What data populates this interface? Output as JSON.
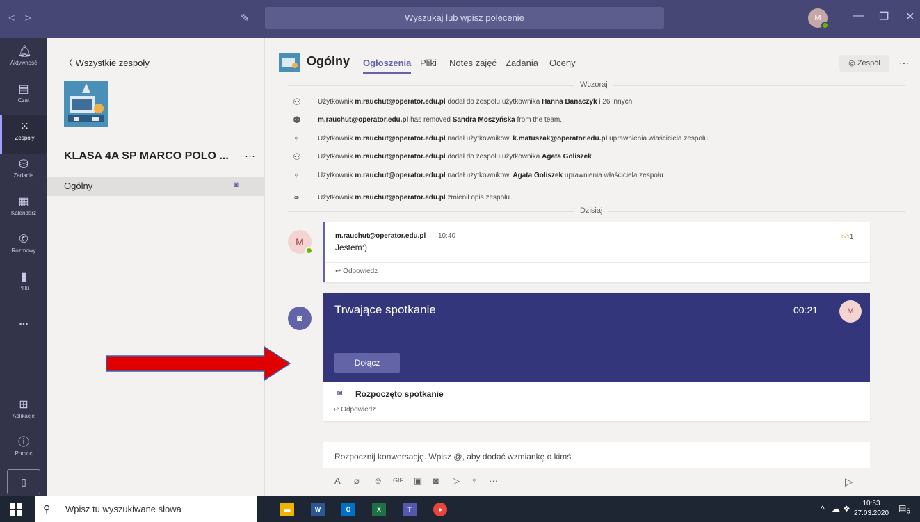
{
  "titlebar": {
    "search_placeholder": "Wyszukaj lub wpisz polecenie",
    "avatar_initial": "M",
    "nav_back": "<",
    "nav_forward": ">"
  },
  "rail": {
    "items": [
      {
        "label": "Aktywność",
        "icon": "bell-icon"
      },
      {
        "label": "Czat",
        "icon": "chat-icon"
      },
      {
        "label": "Zespoły",
        "icon": "teams-icon"
      },
      {
        "label": "Zadania",
        "icon": "assignments-icon"
      },
      {
        "label": "Kalendarz",
        "icon": "calendar-icon"
      },
      {
        "label": "Rozmowy",
        "icon": "phone-icon"
      },
      {
        "label": "Pliki",
        "icon": "file-icon"
      },
      {
        "label": "...",
        "icon": "more-icon"
      },
      {
        "label": "Aplikacje",
        "icon": "apps-icon"
      },
      {
        "label": "Pomoc",
        "icon": "help-icon"
      }
    ],
    "active": "Zespoły"
  },
  "panel": {
    "back_label": "Wszystkie zespoły",
    "team_name": "KLASA 4A SP MARCO POLO ...",
    "team_more": "···",
    "channel_name": "Ogólny"
  },
  "header": {
    "channel": "Ogólny",
    "tabs": [
      "Ogłoszenia",
      "Pliki",
      "Notes zajęć",
      "Zadania",
      "Oceny"
    ],
    "active_tab": "Ogłoszenia",
    "team_button": "Zespół",
    "more": "···"
  },
  "feed": {
    "yesterday": "Wczoraj",
    "today": "Dzisiaj",
    "activities": [
      {
        "icon": "add-user-icon",
        "pre": "Użytkownik ",
        "b1": "m.rauchut@operator.edu.pl",
        "mid": " dodał do zespołu użytkownika ",
        "b2": "Hanna Banaczyk",
        "post": " i 26 innych."
      },
      {
        "icon": "remove-user-icon",
        "pre": "",
        "b1": "m.rauchut@operator.edu.pl",
        "mid": " has removed ",
        "b2": "Sandra Moszyńska",
        "post": " from the team."
      },
      {
        "icon": "owner-icon",
        "pre": "Użytkownik ",
        "b1": "m.rauchut@operator.edu.pl",
        "mid": " nadał użytkownikowi ",
        "b2": "k.matuszak@operator.edu.pl",
        "post": " uprawnienia właściciela zespołu."
      },
      {
        "icon": "add-user-icon",
        "pre": "Użytkownik ",
        "b1": "m.rauchut@operator.edu.pl",
        "mid": " dodał do zespołu użytkownika ",
        "b2": "Agata Goliszek",
        "post": "."
      },
      {
        "icon": "owner-icon",
        "pre": "Użytkownik ",
        "b1": "m.rauchut@operator.edu.pl",
        "mid": " nadał użytkownikowi ",
        "b2": "Agata Goliszek",
        "post": " uprawnienia właściciela zespołu."
      },
      {
        "icon": "team-edit-icon",
        "pre": "Użytkownik ",
        "b1": "m.rauchut@operator.edu.pl",
        "mid": " zmienił opis zespołu.",
        "b2": "",
        "post": ""
      }
    ],
    "message": {
      "avatar": "M",
      "author": "m.rauchut@operator.edu.pl",
      "time": "10:40",
      "body": "Jestem:)",
      "likes": "1",
      "reply": "Odpowiedz"
    },
    "meeting": {
      "title": "Trwające spotkanie",
      "timer": "00:21",
      "avatar": "M",
      "join": "Dołącz",
      "started": "Rozpoczęto spotkanie",
      "reply": "Odpowiedz"
    },
    "compose_placeholder": "Rozpocznij konwersację. Wpisz @, aby dodać wzmiankę o kimś."
  },
  "taskbar": {
    "search_placeholder": "Wpisz tu wyszukiwane słowa",
    "time": "10:53",
    "date": "27.03.2020",
    "notif_count": "6"
  },
  "colors": {
    "titlebar": "#464775",
    "rail": "#33344a",
    "accent": "#6264a7",
    "meeting": "#33367a",
    "arrow": "#e00000"
  }
}
